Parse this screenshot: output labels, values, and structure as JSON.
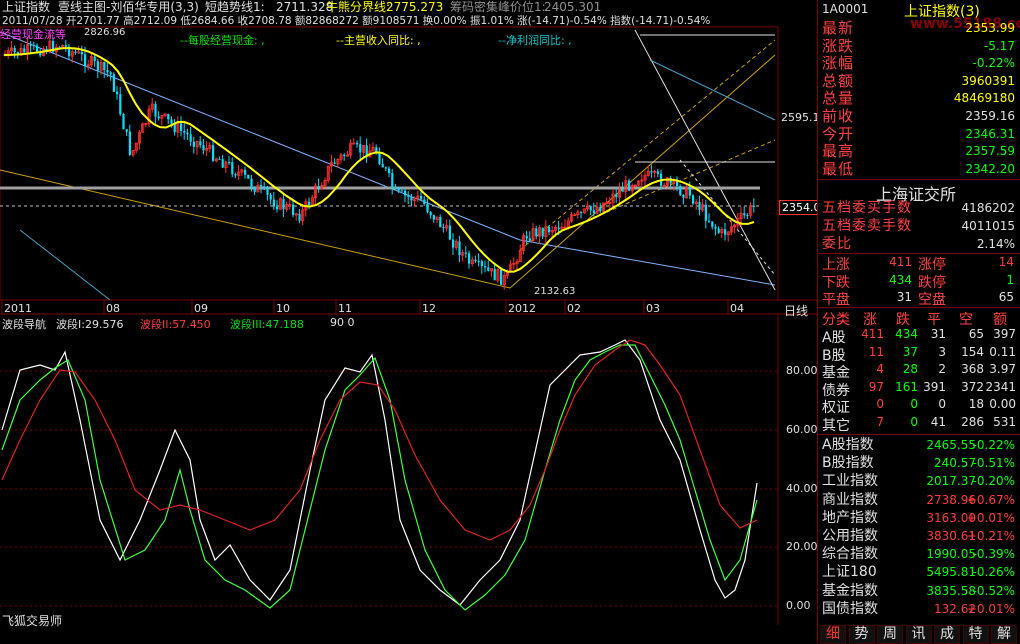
{
  "header": {
    "index_name": "上证指数",
    "chart_title": "壹线主图-刘佰华专用(3,3)",
    "short_trend_label": "短趋势线1:",
    "short_trend_value": "2711.328",
    "bull_bear_label": "牛熊分界线:",
    "bull_bear_value": "2775.273",
    "chip_label": "筹码密集峰价位1:",
    "chip_value": "2405.301",
    "quote_line": "2011/07/28 开2701.77 高2712.09 低2684.66 收2708.78 额82868272 额9108571 换0.00% 振1.01% 涨(-14.71)-0.54% 指数(-14.71)-0.54%",
    "fund_label": "--每股经营现金: ,",
    "income_label": "--主营收入同比: ,",
    "profit_label": "--净利润同比: ,",
    "cash_flow_tag": "经营现金流等"
  },
  "main_chart": {
    "high_label": "2826.96",
    "low_label": "2132.63",
    "price_tick": "2595.1",
    "current_price_tag": "2354.0",
    "x_labels": [
      "2011",
      "08",
      "09",
      "10",
      "11",
      "12",
      "2012",
      "02",
      "03",
      "04"
    ],
    "period_label": "日线"
  },
  "sub_chart": {
    "title": "波段导航",
    "line1": "波段I:29.576",
    "line2": "波段II:57.450",
    "line3": "波段III:47.188",
    "extra": "90 0",
    "y_ticks": [
      "80.00",
      "60.00",
      "40.00",
      "20.00",
      "0.00"
    ],
    "footer": "飞狐交易师"
  },
  "panel": {
    "code": "1A0001",
    "name": "上证指数(3)",
    "watermark": "www.55188.com",
    "quote_rows": [
      {
        "label": "最新",
        "value": "2353.99",
        "color": "#ffff00"
      },
      {
        "label": "涨跌",
        "value": "-5.17",
        "color": "#00ff00"
      },
      {
        "label": "涨幅",
        "value": "-0.22%",
        "color": "#00ff00"
      },
      {
        "label": "总额",
        "value": "3960391",
        "color": "#ffff00"
      },
      {
        "label": "总量",
        "value": "48469180",
        "color": "#ffff00"
      },
      {
        "label": "前收",
        "value": "2359.16",
        "color": "#e0e0e0"
      },
      {
        "label": "今开",
        "value": "2346.31",
        "color": "#00ff00"
      },
      {
        "label": "最高",
        "value": "2357.59",
        "color": "#00ff00"
      },
      {
        "label": "最低",
        "value": "2342.20",
        "color": "#00ff00"
      }
    ],
    "exchange": "上海证交所",
    "order_rows": [
      {
        "label": "五档委买手数",
        "value": "4186202"
      },
      {
        "label": "五档委卖手数",
        "value": "4011015"
      },
      {
        "label": "委比",
        "value": "2.14%"
      }
    ],
    "breadth": {
      "up_label": "上涨",
      "up": "411",
      "limit_up_label": "涨停",
      "limit_up": "14",
      "down_label": "下跌",
      "down": "434",
      "limit_down_label": "跌停",
      "limit_down": "1",
      "flat_label": "平盘",
      "flat": "31",
      "empty_label": "空盘",
      "empty": "65"
    },
    "class_header": [
      "分类",
      "涨",
      "跌",
      "平",
      "空",
      "额"
    ],
    "class_rows": [
      [
        "A股",
        "411",
        "434",
        "31",
        "65",
        "397"
      ],
      [
        "B股",
        "11",
        "37",
        "3",
        "154",
        "0.11"
      ],
      [
        "基金",
        "4",
        "28",
        "2",
        "368",
        "3.97"
      ],
      [
        "债券",
        "97",
        "161",
        "391",
        "372",
        "2341"
      ],
      [
        "权证",
        "0",
        "0",
        "0",
        "18",
        "0.00"
      ],
      [
        "其它",
        "7",
        "0",
        "41",
        "286",
        "531"
      ]
    ],
    "indices": [
      {
        "name": "A股指数",
        "value": "2465.55",
        "pct": "-0.22%",
        "color": "#00ff00"
      },
      {
        "name": "B股指数",
        "value": "240.57",
        "pct": "-0.51%",
        "color": "#00ff00"
      },
      {
        "name": "工业指数",
        "value": "2017.37",
        "pct": "-0.20%",
        "color": "#00ff00"
      },
      {
        "name": "商业指数",
        "value": "2738.96",
        "pct": "+0.67%",
        "color": "#ff3b3b"
      },
      {
        "name": "地产指数",
        "value": "3163.00",
        "pct": "+0.01%",
        "color": "#ff3b3b"
      },
      {
        "name": "公用指数",
        "value": "3830.61",
        "pct": "+0.21%",
        "color": "#ff3b3b"
      },
      {
        "name": "综合指数",
        "value": "1990.05",
        "pct": "-0.39%",
        "color": "#00ff00"
      },
      {
        "name": "上证180",
        "value": "5495.81",
        "pct": "-0.26%",
        "color": "#00ff00"
      },
      {
        "name": "基金指数",
        "value": "3835.58",
        "pct": "-0.52%",
        "color": "#00ff00"
      },
      {
        "name": "国债指数",
        "value": "132.62",
        "pct": "+0.01%",
        "color": "#ff3b3b"
      }
    ],
    "tabs": [
      "细",
      "势",
      "周",
      "讯",
      "成",
      "特",
      "解"
    ]
  }
}
